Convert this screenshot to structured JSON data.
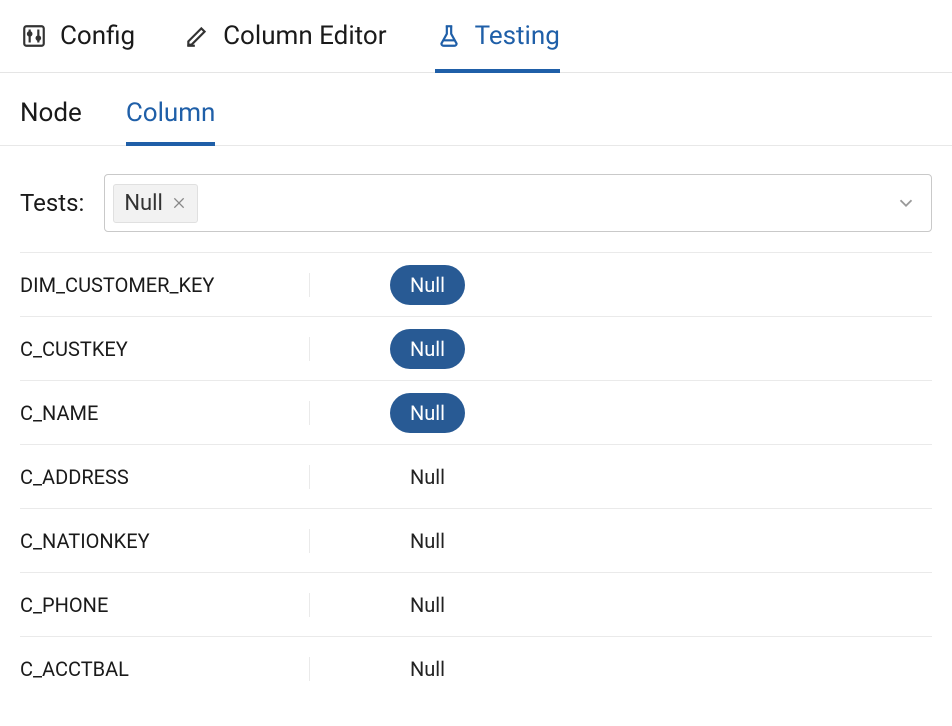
{
  "topTabs": {
    "config": "Config",
    "columnEditor": "Column Editor",
    "testing": "Testing"
  },
  "subTabs": {
    "node": "Node",
    "column": "Column"
  },
  "tests": {
    "label": "Tests:",
    "selected": "Null"
  },
  "rows": [
    {
      "name": "DIM_CUSTOMER_KEY",
      "pill": "Null",
      "active": true
    },
    {
      "name": "C_CUSTKEY",
      "pill": "Null",
      "active": true
    },
    {
      "name": "C_NAME",
      "pill": "Null",
      "active": true
    },
    {
      "name": "C_ADDRESS",
      "pill": "Null",
      "active": false
    },
    {
      "name": "C_NATIONKEY",
      "pill": "Null",
      "active": false
    },
    {
      "name": "C_PHONE",
      "pill": "Null",
      "active": false
    },
    {
      "name": "C_ACCTBAL",
      "pill": "Null",
      "active": false
    }
  ]
}
